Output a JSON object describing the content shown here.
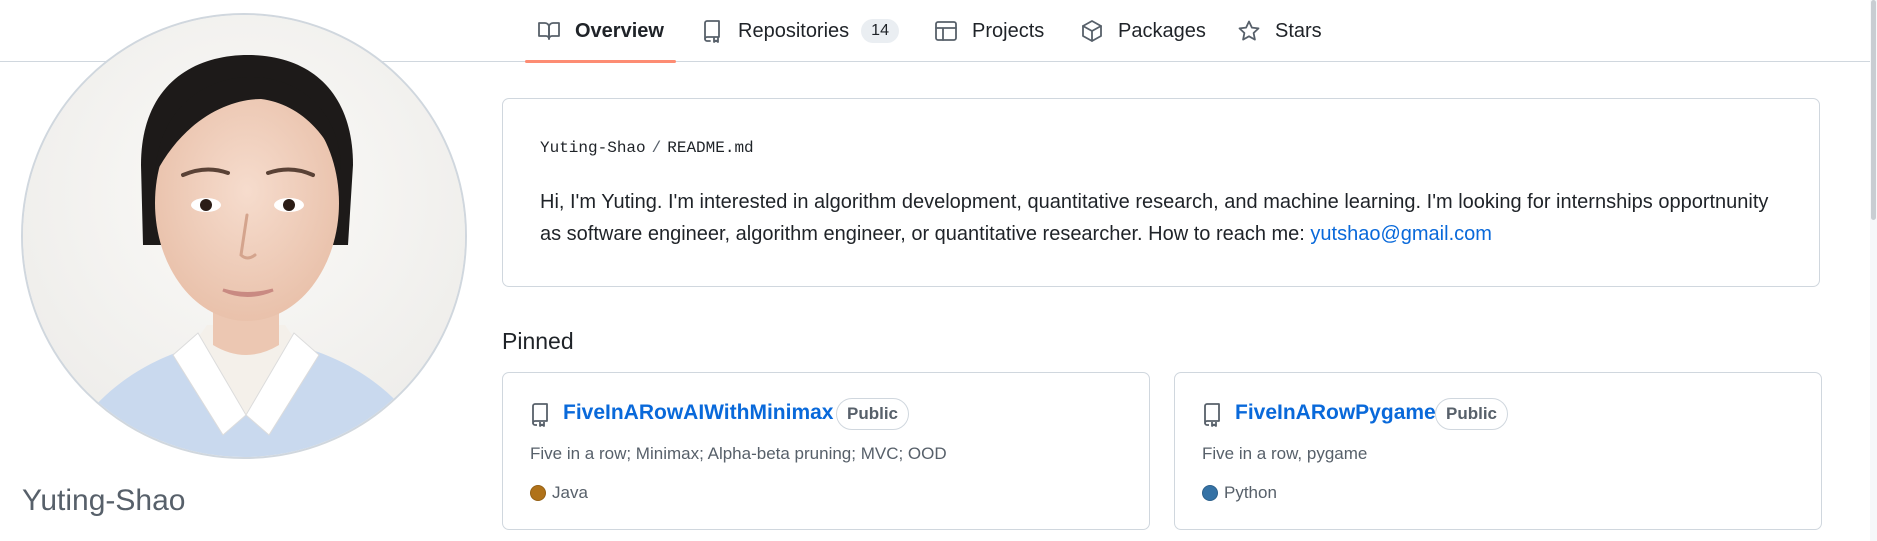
{
  "nav": {
    "tabs": [
      {
        "label": "Overview",
        "icon": "book-icon",
        "active": true
      },
      {
        "label": "Repositories",
        "icon": "repo-icon",
        "count": "14"
      },
      {
        "label": "Projects",
        "icon": "project-table-icon"
      },
      {
        "label": "Packages",
        "icon": "package-icon"
      },
      {
        "label": "Stars",
        "icon": "star-icon"
      }
    ]
  },
  "profile": {
    "name": "Yuting-Shao",
    "avatar_alt": "profile photo"
  },
  "readme": {
    "owner": "Yuting-Shao",
    "separator": "/",
    "file": "README.md",
    "text": "Hi, I'm Yuting. I'm interested in algorithm development, quantitative research, and machine learning. I'm looking for internships opportnunity as software engineer, algorithm engineer, or quantitative researcher. How to reach me: ",
    "email": "yutshao@gmail.com"
  },
  "pinned": {
    "title": "Pinned",
    "repos": [
      {
        "name": "FiveInARowAIWithMinimax",
        "visibility": "Public",
        "description": "Five in a row; Minimax; Alpha-beta pruning; MVC; OOD",
        "language": "Java",
        "language_color": "#b07219"
      },
      {
        "name": "FiveInARowPygame",
        "visibility": "Public",
        "description": "Five in a row, pygame",
        "language": "Python",
        "language_color": "#3572A5"
      }
    ]
  },
  "colors": {
    "accent": "#fd8c73",
    "link": "#0969da"
  }
}
